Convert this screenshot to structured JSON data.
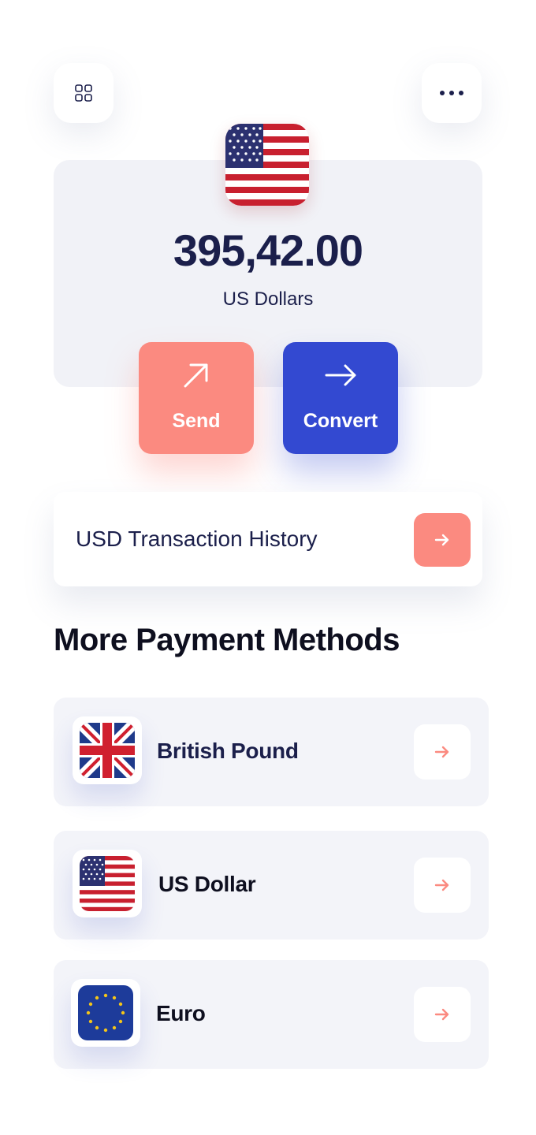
{
  "header": {
    "menu_icon": "grid-icon",
    "more_icon": "more-horizontal-icon"
  },
  "balance": {
    "flag": "us-flag",
    "amount": "395,42.00",
    "currency_label": "US Dollars"
  },
  "actions": {
    "send_label": "Send",
    "convert_label": "Convert"
  },
  "history": {
    "label": "USD Transaction History"
  },
  "payment_methods": {
    "title": "More Payment Methods",
    "items": [
      {
        "name": "British Pound",
        "flag": "uk-flag"
      },
      {
        "name": "US Dollar",
        "flag": "us-flag"
      },
      {
        "name": "Euro",
        "flag": "eu-flag"
      }
    ]
  },
  "colors": {
    "navy_text": "#1b1f4b",
    "coral": "#fb8a80",
    "blue": "#3349d1",
    "card_bg": "#f1f2f7"
  }
}
